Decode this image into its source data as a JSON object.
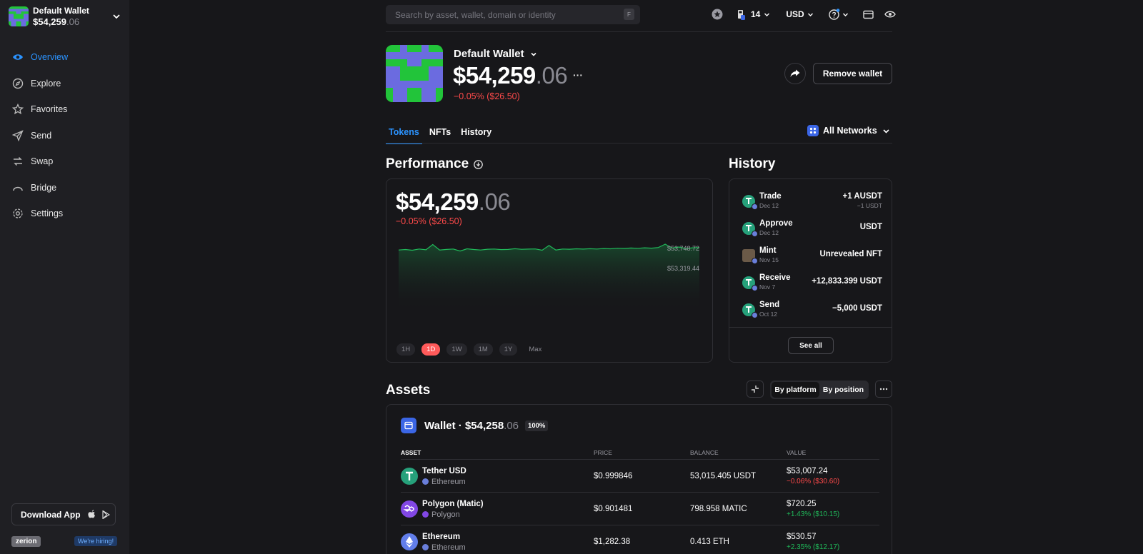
{
  "sidebar": {
    "wallet_name": "Default Wallet",
    "wallet_balance_int": "$54,259",
    "wallet_balance_dec": ".06",
    "nav": [
      {
        "label": "Overview",
        "icon": "eye-icon",
        "active": true
      },
      {
        "label": "Explore",
        "icon": "compass-icon"
      },
      {
        "label": "Favorites",
        "icon": "star-icon"
      },
      {
        "label": "Send",
        "icon": "send-icon"
      },
      {
        "label": "Swap",
        "icon": "swap-icon"
      },
      {
        "label": "Bridge",
        "icon": "bridge-icon"
      },
      {
        "label": "Settings",
        "icon": "gear-icon"
      }
    ],
    "download_label": "Download App",
    "brand": "zerion",
    "hiring": "We're hiring!"
  },
  "topbar": {
    "search_placeholder": "Search by asset, wallet, domain or identity",
    "search_shortcut": "F",
    "gas_value": "14",
    "currency": "USD"
  },
  "header": {
    "wallet_name": "Default Wallet",
    "balance_int": "$54,259",
    "balance_dec": ".06",
    "more": "···",
    "change": "−0.05% ($26.50)",
    "remove_label": "Remove wallet"
  },
  "tabs": [
    "Tokens",
    "NFTs",
    "History"
  ],
  "active_tab": "Tokens",
  "networks_label": "All Networks",
  "performance": {
    "title": "Performance",
    "balance_int": "$54,259",
    "balance_dec": ".06",
    "change": "−0.05% ($26.50)",
    "label_high": "$53,748.72",
    "label_low": "$53,319.44",
    "ranges": [
      "1H",
      "1D",
      "1W",
      "1M",
      "1Y",
      "Max"
    ],
    "active_range": "1D"
  },
  "chart_data": {
    "type": "area",
    "title": "",
    "series": [
      {
        "values": [
          53690,
          53695,
          53688,
          53700,
          53692,
          53745,
          53690,
          53696,
          53700,
          53680,
          53702,
          53695,
          53690,
          53698,
          53700,
          53694,
          53696,
          53703,
          53697,
          53699,
          53701,
          53688,
          53735,
          53690,
          53700,
          53698,
          53702,
          53699,
          53703,
          53700,
          53705,
          53702,
          53708,
          53706,
          53710,
          53707,
          53712,
          53709,
          53715,
          53748.72,
          53710,
          53720,
          53705,
          53712,
          53715
        ]
      }
    ],
    "annotations": [
      "$53,748.72",
      "$53,319.44"
    ],
    "color": "#20b95a"
  },
  "history": {
    "title": "History",
    "items": [
      {
        "type": "Trade",
        "date": "Dec 12",
        "amount": "+1 AUSDT",
        "sub": "−1 USDT",
        "coin": "tether"
      },
      {
        "type": "Approve",
        "date": "Dec 12",
        "amount": "USDT",
        "sub": "",
        "coin": "tether"
      },
      {
        "type": "Mint",
        "date": "Nov 15",
        "amount": "Unrevealed NFT",
        "sub": "",
        "coin": "nft"
      },
      {
        "type": "Receive",
        "date": "Nov 7",
        "amount": "+12,833.399 USDT",
        "sub": "",
        "coin": "tether"
      },
      {
        "type": "Send",
        "date": "Oct 12",
        "amount": "−5,000 USDT",
        "sub": "",
        "coin": "tether"
      }
    ],
    "see_all": "See all"
  },
  "assets": {
    "title": "Assets",
    "view_options": [
      "By platform",
      "By position"
    ],
    "active_view": "By platform",
    "wallet_label": "Wallet · $54,258",
    "wallet_dec": ".06",
    "wallet_pct": "100%",
    "columns": [
      "ASSET",
      "PRICE",
      "BALANCE",
      "VALUE"
    ],
    "rows": [
      {
        "name": "Tether USD",
        "network": "Ethereum",
        "price": "$0.999846",
        "balance": "53,015.405 USDT",
        "value": "$53,007.24",
        "change": "−0.06% ($30.60)",
        "dir": "down",
        "icon_color": "#26a17b",
        "net_color": "#6a7fdb"
      },
      {
        "name": "Polygon (Matic)",
        "network": "Polygon",
        "price": "$0.901481",
        "balance": "798.958 MATIC",
        "value": "$720.25",
        "change": "+1.43% ($10.15)",
        "dir": "up",
        "icon_color": "#8247e5",
        "net_color": "#8247e5"
      },
      {
        "name": "Ethereum",
        "network": "Ethereum",
        "price": "$1,282.38",
        "balance": "0.413 ETH",
        "value": "$530.57",
        "change": "+2.35% ($12.17)",
        "dir": "up",
        "icon_color": "#627eea",
        "net_color": "#6a7fdb"
      }
    ]
  },
  "colors": {
    "accent": "#2b93ff",
    "negative": "#ff4a4a",
    "positive": "#20b95a",
    "avatar_green": "#22c43a",
    "avatar_purple": "#6b6be0"
  }
}
